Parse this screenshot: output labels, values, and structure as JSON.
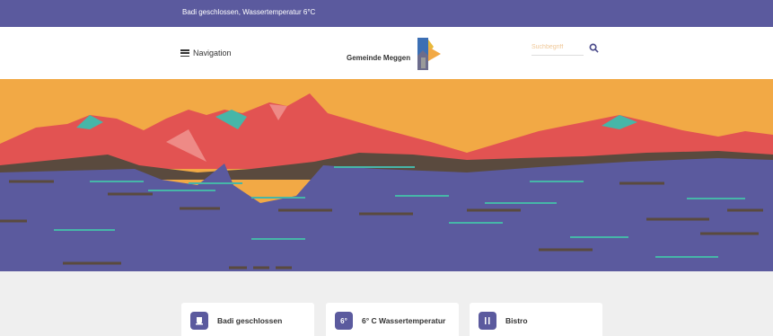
{
  "announcement": {
    "text": "Badi geschlossen, Wassertemperatur 6°C"
  },
  "header": {
    "nav_label": "Navigation",
    "logo_text": "Gemeinde Meggen",
    "search_placeholder": "Suchbegriff"
  },
  "colors": {
    "brand": "#5b5a9e",
    "sky": "#f2a945",
    "mountain": "#e25352",
    "glacier": "#46b6a8",
    "shore": "#5a4a3e",
    "lake": "#5b5a9e"
  },
  "cards": [
    {
      "icon": "bath-icon",
      "icon_text": "",
      "label": "Badi geschlossen"
    },
    {
      "icon": "temperature-icon",
      "icon_text": "6°",
      "label": "6° C Wassertemperatur"
    },
    {
      "icon": "cutlery-icon",
      "icon_text": "",
      "label": "Bistro"
    }
  ]
}
